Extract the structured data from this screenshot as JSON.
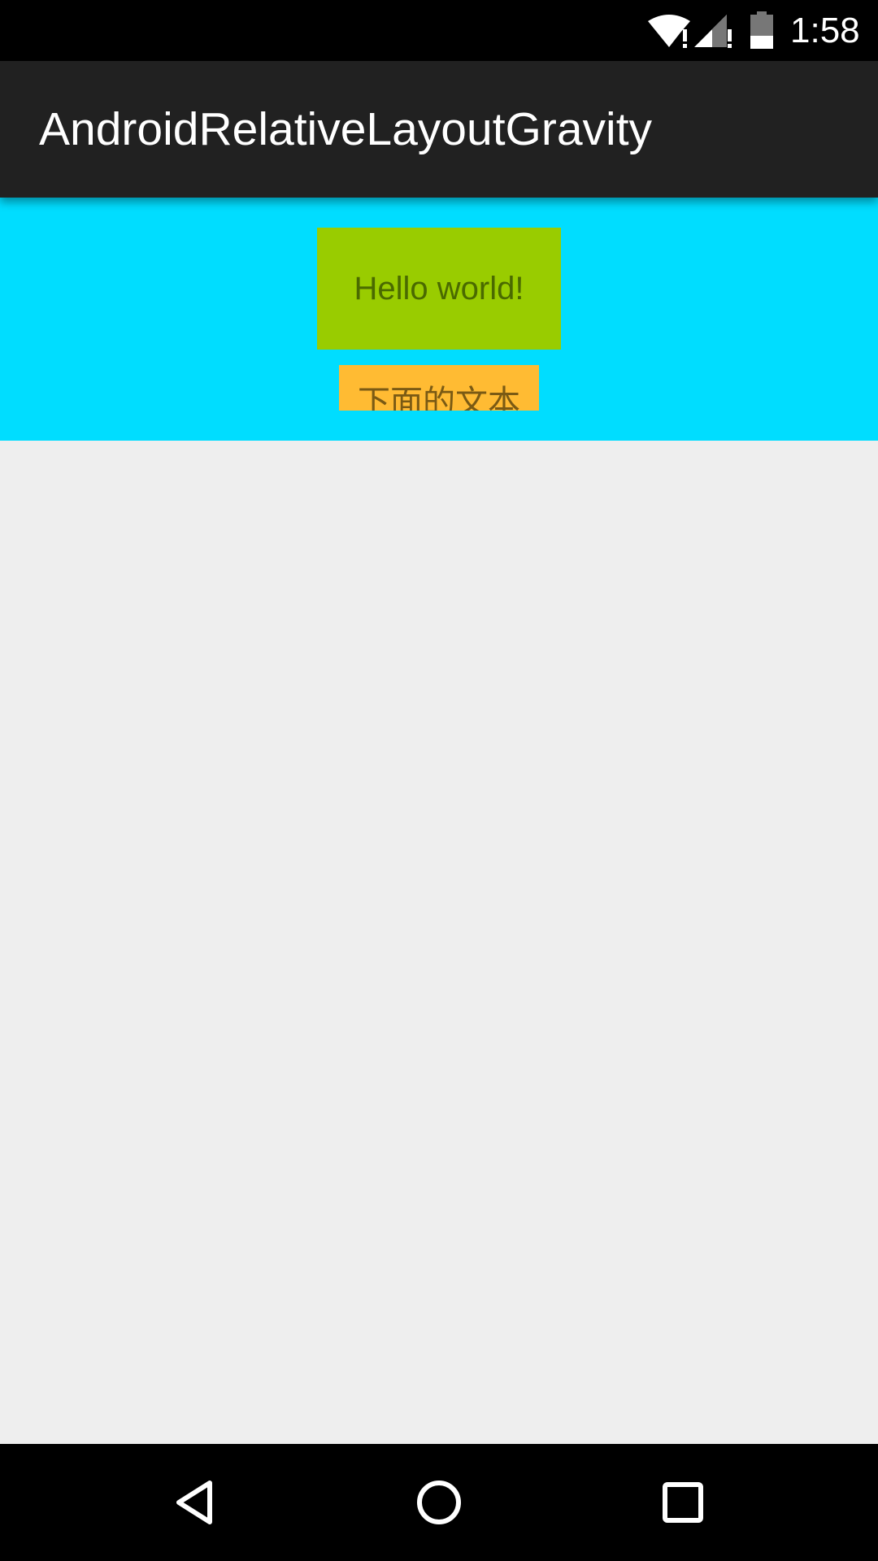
{
  "status_bar": {
    "time": "1:58",
    "icons": [
      "wifi-alert-icon",
      "signal-alert-icon",
      "battery-icon"
    ]
  },
  "action_bar": {
    "title": "AndroidRelativeLayoutGravity"
  },
  "content": {
    "background_color": "#eeeeee",
    "relative_layout": {
      "background_color": "#00ddff",
      "hello_text": "Hello world!",
      "hello_background": "#99cc00",
      "clipped_text": "下面的文本",
      "clipped_background": "#ffbb33"
    }
  },
  "nav_bar": {
    "buttons": [
      "back-icon",
      "home-icon",
      "recent-apps-icon"
    ]
  }
}
